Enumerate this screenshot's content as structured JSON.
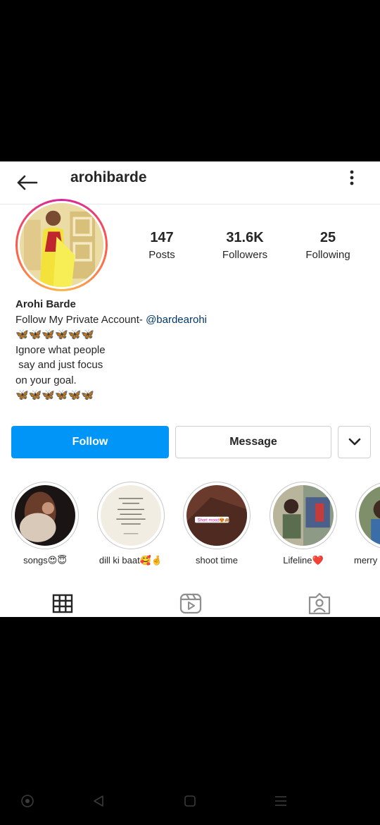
{
  "header": {
    "username": "arohibarde",
    "back_icon": "arrow-left-icon",
    "more_icon": "vertical-dots-icon"
  },
  "profile": {
    "stats": [
      {
        "value": "147",
        "label": "Posts"
      },
      {
        "value": "31.6K",
        "label": "Followers"
      },
      {
        "value": "25",
        "label": "Following"
      }
    ],
    "bio": {
      "name": "Arohi Barde",
      "line1_text": "Follow My Private Account- ",
      "mention": "@bardearohi",
      "butterflies": "🦋🦋🦋🦋🦋🦋",
      "line3": "Ignore what people",
      "line4": " say and just focus",
      "line5": "on your goal.",
      "butterflies2": "🦋🦋🦋🦋🦋🦋"
    }
  },
  "actions": {
    "follow_label": "Follow",
    "message_label": "Message",
    "dropdown_icon": "chevron-down-icon"
  },
  "highlights": [
    {
      "label": "songs😍😇"
    },
    {
      "label": "dill ki baat🥰🤞"
    },
    {
      "label": "shoot time"
    },
    {
      "label": "Lifeline❤️"
    },
    {
      "label": "merry"
    }
  ],
  "highlight_overlay": {
    "shoot_sticker": "Short mood😍🙈"
  },
  "tabs": [
    "grid-icon",
    "reels-icon",
    "tagged-icon"
  ],
  "colors": {
    "accent": "#0095f6",
    "mention": "#00376b",
    "text": "#262626"
  }
}
